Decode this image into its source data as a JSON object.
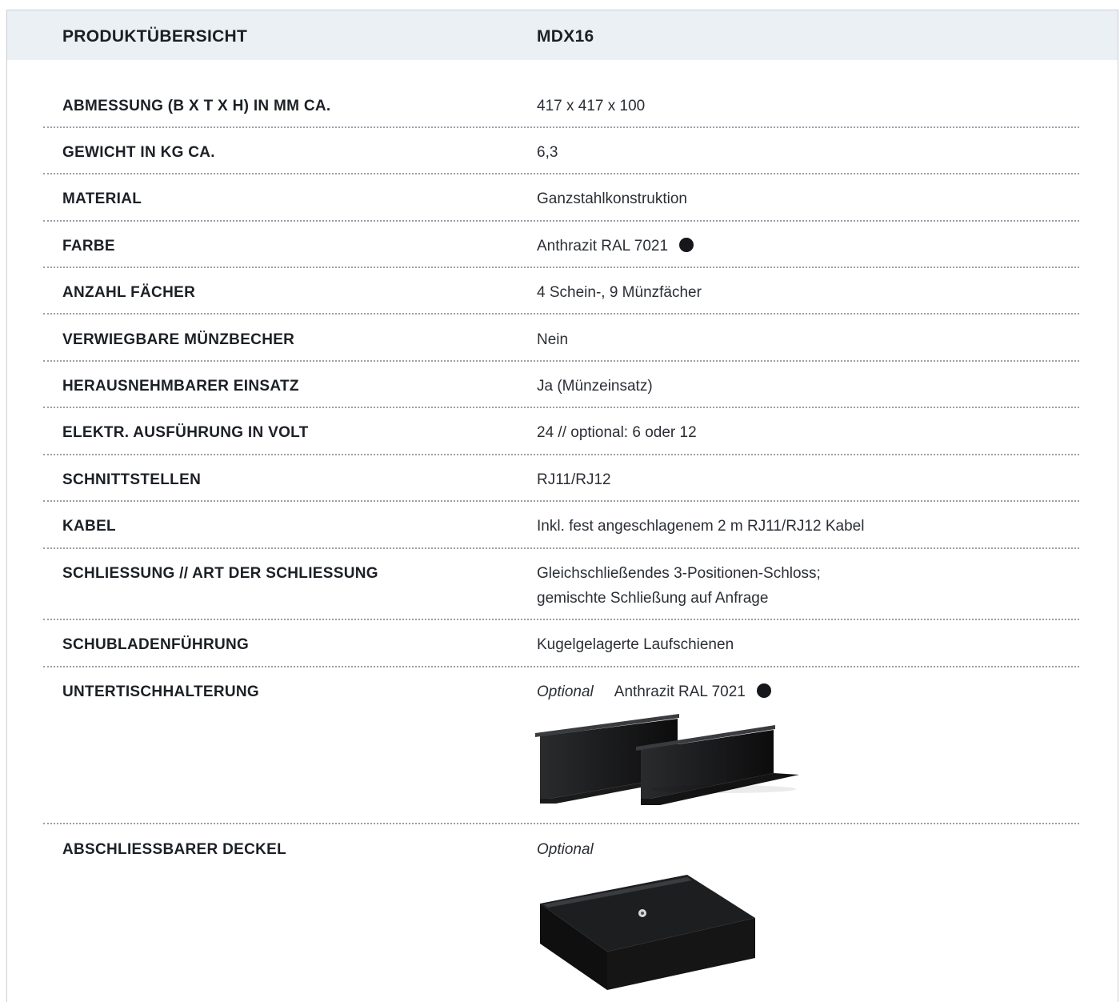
{
  "header": {
    "label": "PRODUKTÜBERSICHT",
    "model": "MDX16"
  },
  "rows": [
    {
      "label": "ABMESSUNG (B X T X H) IN MM CA.",
      "value": "417 x 417 x 100"
    },
    {
      "label": "GEWICHT IN KG CA.",
      "value": "6,3"
    },
    {
      "label": "MATERIAL",
      "value": "Ganzstahlkonstruktion"
    },
    {
      "label": "FARBE",
      "value": "Anthrazit RAL 7021"
    },
    {
      "label": "ANZAHL FÄCHER",
      "value": "4 Schein-, 9 Münzfächer"
    },
    {
      "label": "VERWIEGBARE MÜNZBECHER",
      "value": "Nein"
    },
    {
      "label": "HERAUSNEHMBARER EINSATZ",
      "value": "Ja (Münzeinsatz)"
    },
    {
      "label": "ELEKTR. AUSFÜHRUNG IN VOLT",
      "value": "24 // optional: 6 oder 12"
    },
    {
      "label": "SCHNITTSTELLEN",
      "value": "RJ11/RJ12"
    },
    {
      "label": "KABEL",
      "value": "Inkl. fest angeschlagenem 2 m RJ11/RJ12 Kabel"
    },
    {
      "label": "SCHLIESSUNG // ART DER SCHLIESSUNG",
      "value_line1": "Gleichschließendes 3-Positionen-Schloss;",
      "value_line2": "gemischte Schließung auf Anfrage"
    },
    {
      "label": "SCHUBLADENFÜHRUNG",
      "value": "Kugelgelagerte Laufschienen"
    },
    {
      "label": "UNTERTISCHHALTERUNG",
      "optional": "Optional",
      "value": "Anthrazit RAL 7021",
      "image": "under-desk-bracket-image"
    },
    {
      "label": "ABSCHLIESSBARER DECKEL",
      "optional": "Optional",
      "image": "lockable-lid-image"
    }
  ],
  "colors": {
    "header_bg": "#ebf0f5",
    "color_dot": "#15171a",
    "divider": "#9aa0a8"
  }
}
